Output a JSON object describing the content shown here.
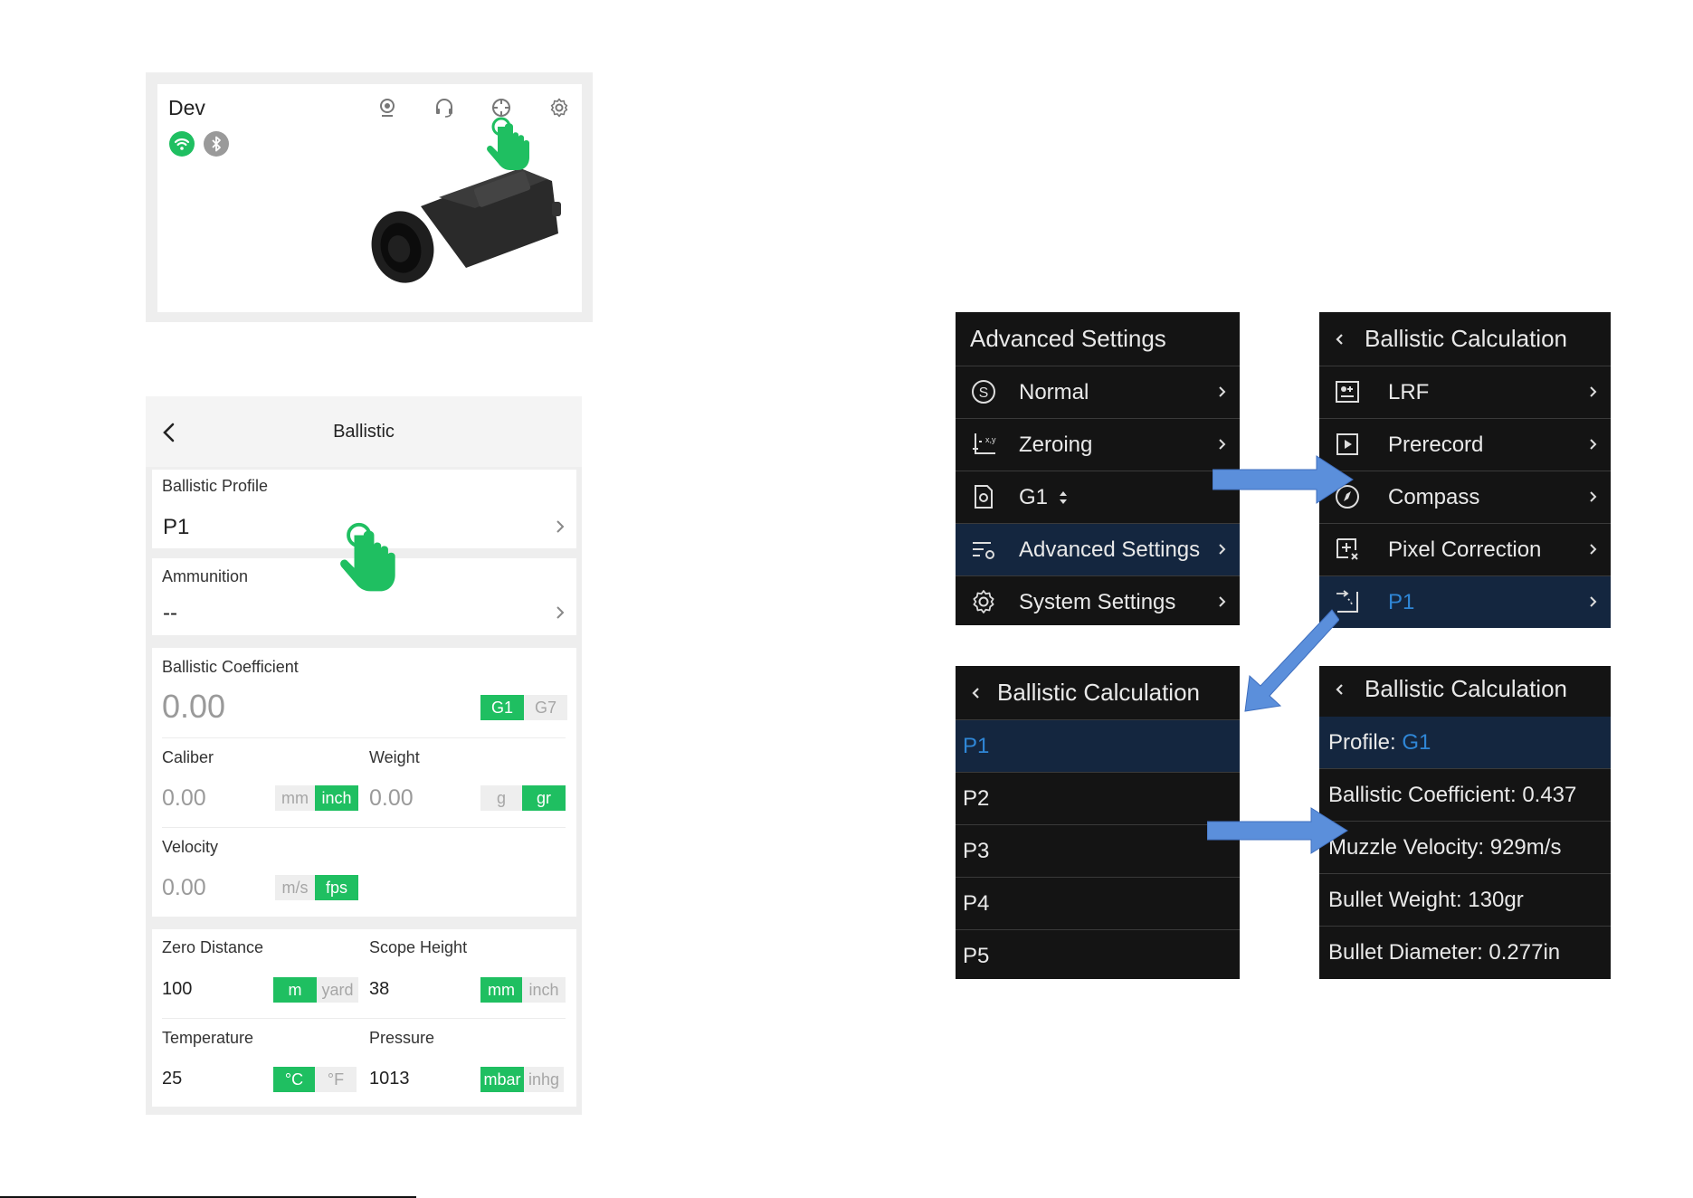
{
  "device_card": {
    "name": "Dev",
    "icons": [
      "camera-icon",
      "headset-icon",
      "crosshair-icon",
      "gear-icon"
    ],
    "status_badges": [
      "wifi-icon",
      "bluetooth-icon"
    ]
  },
  "ballistic_app": {
    "title": "Ballistic",
    "profile_label": "Ballistic Profile",
    "profile_value": "P1",
    "ammo_label": "Ammunition",
    "ammo_value": "--",
    "bc_label": "Ballistic Coefficient",
    "bc_value": "0.00",
    "bc_units": [
      "G1",
      "G7"
    ],
    "bc_selected": "G1",
    "caliber_label": "Caliber",
    "caliber_value": "0.00",
    "caliber_units": [
      "mm",
      "inch"
    ],
    "caliber_selected": "inch",
    "weight_label": "Weight",
    "weight_value": "0.00",
    "weight_units": [
      "g",
      "gr"
    ],
    "weight_selected": "gr",
    "velocity_label": "Velocity",
    "velocity_value": "0.00",
    "velocity_units": [
      "m/s",
      "fps"
    ],
    "velocity_selected": "fps",
    "zero_label": "Zero Distance",
    "zero_value": "100",
    "zero_units": [
      "m",
      "yard"
    ],
    "zero_selected": "m",
    "scope_label": "Scope Height",
    "scope_value": "38",
    "scope_units": [
      "mm",
      "inch"
    ],
    "scope_selected": "mm",
    "temp_label": "Temperature",
    "temp_value": "25",
    "temp_units": [
      "°C",
      "°F"
    ],
    "temp_selected": "°C",
    "pressure_label": "Pressure",
    "pressure_value": "1013",
    "pressure_units": [
      "mbar",
      "inhg"
    ],
    "pressure_selected": "mbar"
  },
  "screen_advanced": {
    "title": "Advanced Settings",
    "items": [
      {
        "label": "Normal",
        "icon": "s-circle-icon"
      },
      {
        "label": "Zeroing",
        "icon": "xy-axis-icon"
      },
      {
        "label": "G1",
        "icon": "file-gear-icon"
      },
      {
        "label": "Advanced Settings",
        "icon": "sliders-gear-icon"
      },
      {
        "label": "System Settings",
        "icon": "gear-icon"
      }
    ]
  },
  "screen_ballistic_menu": {
    "title": "Ballistic Calculation",
    "items": [
      {
        "label": "LRF",
        "icon": "rangefinder-icon"
      },
      {
        "label": "Prerecord",
        "icon": "play-box-icon"
      },
      {
        "label": "Compass",
        "icon": "compass-icon"
      },
      {
        "label": "Pixel Correction",
        "icon": "pixel-correction-icon"
      },
      {
        "label": "P1",
        "icon": "trajectory-icon"
      }
    ]
  },
  "screen_profiles": {
    "title": "Ballistic Calculation",
    "items": [
      "P1",
      "P2",
      "P3",
      "P4",
      "P5"
    ]
  },
  "screen_profile_detail": {
    "title": "Ballistic Calculation",
    "profile_prefix": "Profile: ",
    "profile_value": "G1",
    "lines": [
      "Ballistic Coefficient: 0.437",
      "Muzzle Velocity: 929m/s",
      "Bullet Weight: 130gr",
      "Bullet Diameter: 0.277in"
    ]
  },
  "colors": {
    "accent_green": "#1fbf61",
    "screen_bg": "#141414",
    "screen_selected": "#14263f",
    "screen_blue_text": "#2f86d6",
    "arrow_blue": "#5b8fdb"
  }
}
